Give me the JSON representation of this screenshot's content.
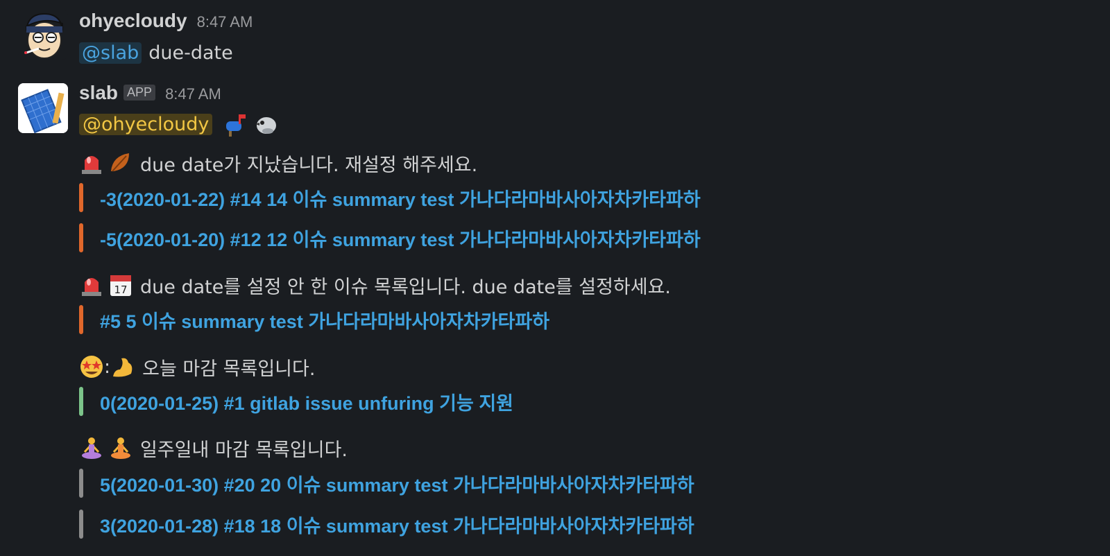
{
  "messages": [
    {
      "author": "ohyecloudy",
      "time": "8:47 AM",
      "mention": "@slab",
      "text": "due-date"
    },
    {
      "author": "slab",
      "badge": "APP",
      "time": "8:47 AM",
      "mention": "@ohyecloudy",
      "sections": [
        {
          "emojis": [
            "rotating-light-emoji",
            "fallen-leaf-emoji"
          ],
          "text": "due date가 지났습니다. 재설정 해주세요.",
          "items": [
            {
              "text": "-3(2020-01-22) #14 14 이슈 summary test 가나다라마바사아자차카타파하",
              "color": "#e0672b"
            },
            {
              "text": "-5(2020-01-20) #12 12 이슈 summary test 가나다라마바사아자차카타파하",
              "color": "#e0672b"
            }
          ]
        },
        {
          "emojis": [
            "rotating-light-emoji",
            "calendar-emoji"
          ],
          "text": "due date를 설정 안 한 이슈 목록입니다. due date를 설정하세요.",
          "items": [
            {
              "text": "#5 5 이슈 summary test 가나다라마바사아자차카타파하",
              "color": "#e0672b"
            }
          ]
        },
        {
          "emojis": [
            "star-struck-emoji",
            "flexed-biceps-emoji"
          ],
          "separator": ":",
          "text": "오늘 마감 목록입니다.",
          "items": [
            {
              "text": "0(2020-01-25) #1 gitlab issue unfuring 기능 지원",
              "color": "#7cc48a"
            }
          ]
        },
        {
          "emojis": [
            "person-lotus-position-emoji",
            "person-lotus-position-emoji"
          ],
          "text": "일주일내 마감 목록입니다.",
          "items": [
            {
              "text": "5(2020-01-30) #20 20 이슈 summary test 가나다라마바사아자차카타파하",
              "color": "#8c8c8c"
            },
            {
              "text": "3(2020-01-28) #18 18 이슈 summary test 가나다라마바사아자차카타파하",
              "color": "#8c8c8c"
            }
          ]
        }
      ]
    }
  ]
}
